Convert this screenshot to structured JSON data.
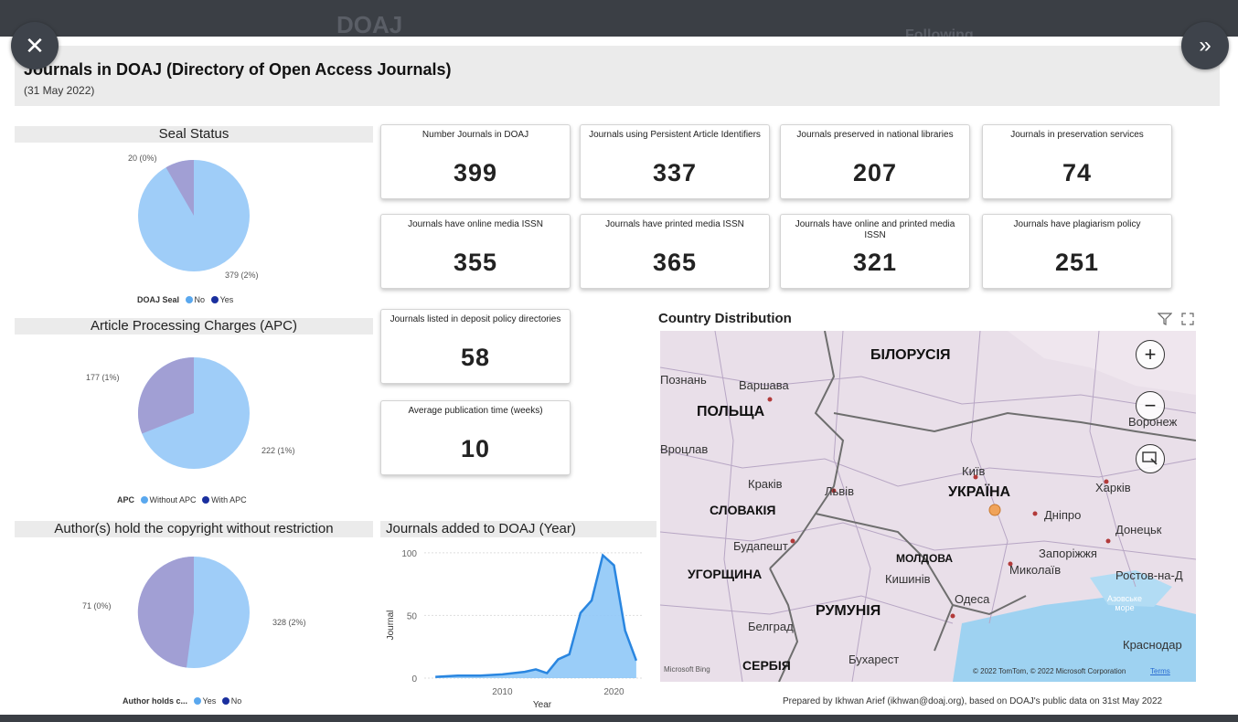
{
  "app": {
    "bg_ghost_title": "DOAJ",
    "bg_ghost_following": "Following"
  },
  "header": {
    "title": "Journals in DOAJ (Directory of Open Access Journals)",
    "date": "(31 May 2022)"
  },
  "nav": {
    "close_glyph": "✕",
    "next_glyph": "»"
  },
  "pies": [
    {
      "title": "Seal Status",
      "legend_title": "DOAJ Seal",
      "legend": [
        {
          "label": "No",
          "color": "#5aa8ee"
        },
        {
          "label": "Yes",
          "color": "#1a2f9e"
        }
      ],
      "labels": [
        "20 (0%)",
        "379 (2%)"
      ]
    },
    {
      "title": "Article Processing Charges (APC)",
      "legend_title": "APC",
      "legend": [
        {
          "label": "Without APC",
          "color": "#5aa8ee"
        },
        {
          "label": "With APC",
          "color": "#1a2f9e"
        }
      ],
      "labels": [
        "177 (1%)",
        "222 (1%)"
      ]
    },
    {
      "title": "Author(s) hold the copyright without restriction",
      "legend_title": "Author holds c...",
      "legend": [
        {
          "label": "Yes",
          "color": "#5aa8ee"
        },
        {
          "label": "No",
          "color": "#1a2f9e"
        }
      ],
      "labels": [
        "71 (0%)",
        "328 (2%)"
      ]
    }
  ],
  "cards": [
    {
      "label": "Number Journals in DOAJ",
      "value": "399"
    },
    {
      "label": "Journals using Persistent Article Identifiers",
      "value": "337"
    },
    {
      "label": "Journals preserved in national libraries",
      "value": "207"
    },
    {
      "label": "Journals in preservation services",
      "value": "74"
    },
    {
      "label": "Journals have online media ISSN",
      "value": "355"
    },
    {
      "label": "Journals have printed media ISSN",
      "value": "365"
    },
    {
      "label": "Journals have online and printed media ISSN",
      "value": "321"
    },
    {
      "label": "Journals have plagiarism policy",
      "value": "251"
    },
    {
      "label": "Journals listed in deposit policy directories",
      "value": "58"
    },
    {
      "label": "Average publication time (weeks)",
      "value": "10"
    }
  ],
  "map": {
    "title": "Country Distribution",
    "zoom_in": "+",
    "zoom_out": "−",
    "countries": [
      "БІЛОРУСІЯ",
      "ПОЛЬЩА",
      "УКРАЇНА",
      "СЛОВАКІЯ",
      "МОЛДОВА",
      "УГОРЩИНА",
      "РУМУНІЯ",
      "СЕРБІЯ"
    ],
    "cities": [
      "Познань",
      "Варшава",
      "Вроцлав",
      "Краків",
      "Львів",
      "Київ",
      "Харків",
      "Воронеж",
      "Дніпро",
      "Донецьк",
      "Будапешт",
      "Запоріжжя",
      "Миколаїв",
      "Кишинів",
      "Одеса",
      "Ростов-на-Д",
      "Азовське море",
      "Белград",
      "Бухарест",
      "Краснодар",
      "Донецьк"
    ],
    "attribution": "© 2022 TomTom, © 2022 Microsoft Corporation",
    "terms": "Terms",
    "bing": "Microsoft Bing"
  },
  "footer": {
    "prepared": "Prepared by Ikhwan Arief (ikhwan@doaj.org), based on DOAJ's public data on 31st May 2022"
  },
  "colors": {
    "pie_light": "#9fcdf8",
    "pie_dark": "#a19fd4",
    "line": "#2a86e0",
    "area": "#8fc8f7"
  },
  "chart_data": {
    "type": "area",
    "title": "Journals added to DOAJ (Year)",
    "xlabel": "Year",
    "ylabel": "Journal",
    "x": [
      2004,
      2006,
      2008,
      2010,
      2012,
      2013,
      2014,
      2015,
      2016,
      2017,
      2018,
      2019,
      2020,
      2021,
      2022
    ],
    "values": [
      1,
      2,
      2,
      3,
      5,
      7,
      4,
      15,
      19,
      52,
      62,
      98,
      90,
      38,
      14
    ],
    "xticks": [
      2010,
      2020
    ],
    "yticks": [
      0,
      50,
      100
    ],
    "xlim": [
      2003,
      2022.5
    ],
    "ylim": [
      0,
      105
    ],
    "grid": true
  }
}
